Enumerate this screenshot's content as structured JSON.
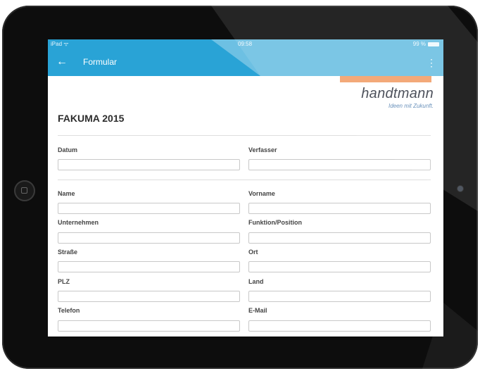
{
  "status_bar": {
    "device": "iPad",
    "wifi_icon": "wifi-icon",
    "time": "09:58",
    "battery": "99 %"
  },
  "app_bar": {
    "back_icon": "arrow-left-icon",
    "title": "Formular",
    "menu_icon": "more-vert-icon"
  },
  "logo": {
    "brand": "handtmann",
    "tagline": "Ideen mit Zukunft.",
    "accent_color": "#f2a06a"
  },
  "form": {
    "title": "FAKUMA 2015",
    "fields": {
      "datum": {
        "label": "Datum",
        "value": ""
      },
      "verfasser": {
        "label": "Verfasser",
        "value": ""
      },
      "name": {
        "label": "Name",
        "value": ""
      },
      "vorname": {
        "label": "Vorname",
        "value": ""
      },
      "unternehmen": {
        "label": "Unternehmen",
        "value": ""
      },
      "funktion": {
        "label": "Funktion/Position",
        "value": ""
      },
      "strasse": {
        "label": "Straße",
        "value": ""
      },
      "ort": {
        "label": "Ort",
        "value": ""
      },
      "plz": {
        "label": "PLZ",
        "value": ""
      },
      "land": {
        "label": "Land",
        "value": ""
      },
      "telefon": {
        "label": "Telefon",
        "value": ""
      },
      "email": {
        "label": "E-Mail",
        "value": ""
      }
    }
  },
  "colors": {
    "appbar": "#29a3d6",
    "device": "#0d0d0d"
  }
}
